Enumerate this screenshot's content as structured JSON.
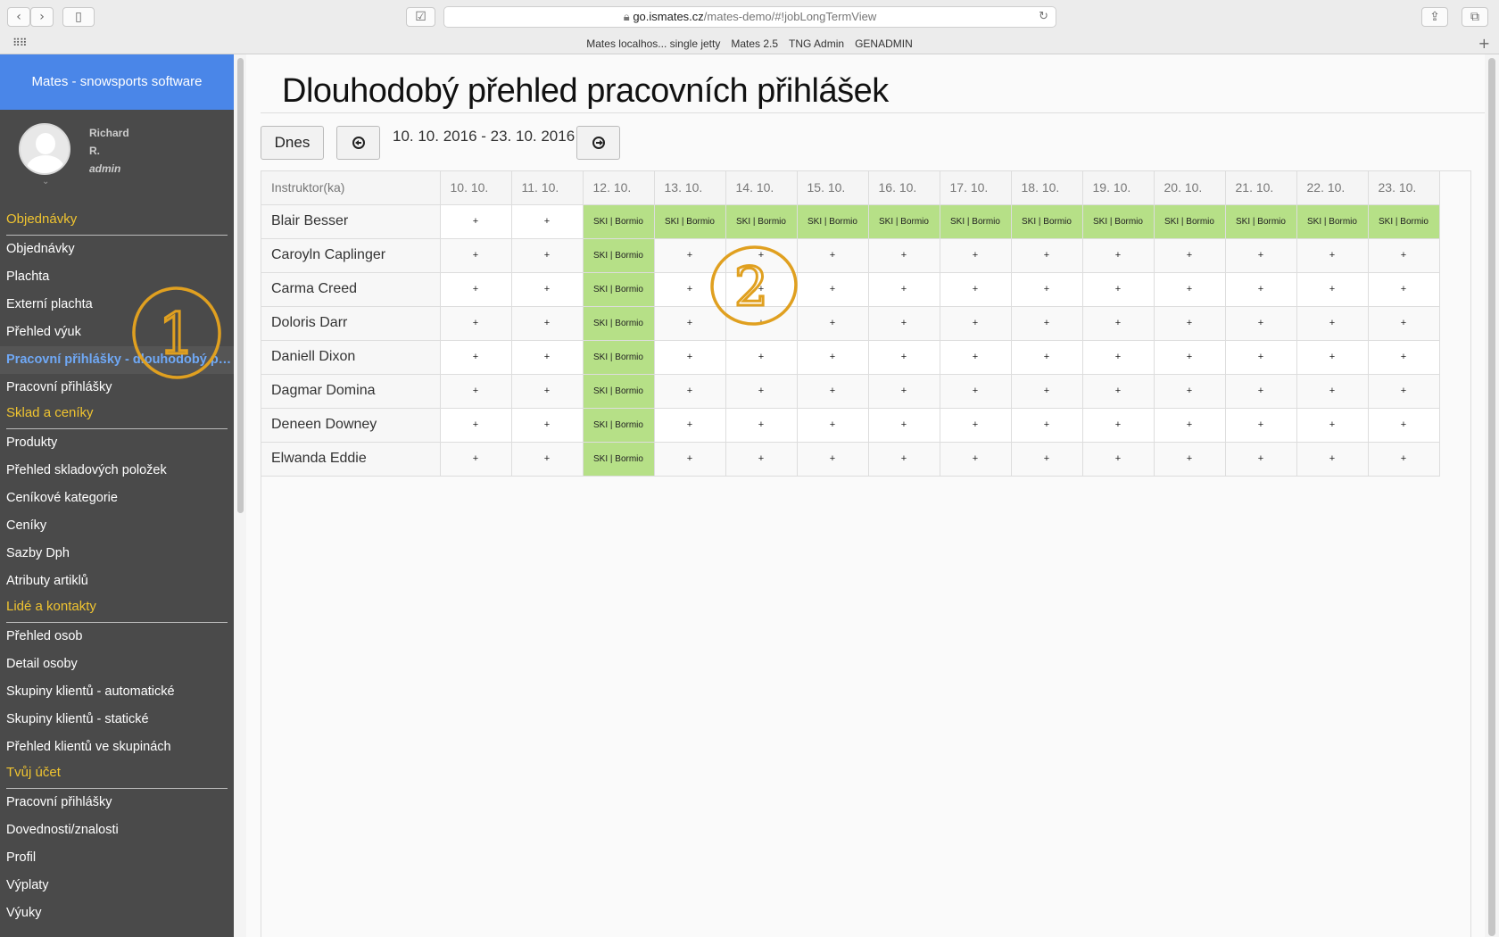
{
  "browser": {
    "url_host": "go.ismates.cz",
    "url_path": "/mates-demo/#!jobLongTermView",
    "bookmarks": [
      "Mates localhos... single jetty",
      "Mates 2.5",
      "TNG Admin",
      "GENADMIN"
    ]
  },
  "sidebar": {
    "brand": "Mates - snowsports software",
    "user": {
      "first": "Richard",
      "last": "R.",
      "role": "admin"
    },
    "sections": [
      {
        "title": "Objednávky",
        "items": [
          "Objednávky",
          "Plachta",
          "Externí plachta",
          "Přehled výuk",
          "Pracovní přihlášky - dlouhodobý přehled",
          "Pracovní přihlášky"
        ]
      },
      {
        "title": "Sklad a ceníky",
        "items": [
          "Produkty",
          "Přehled skladových položek",
          "Ceníkové kategorie",
          "Ceníky",
          "Sazby Dph",
          "Atributy artiklů"
        ]
      },
      {
        "title": "Lidé a kontakty",
        "items": [
          "Přehled osob",
          "Detail osoby",
          "Skupiny klientů - automatické",
          "Skupiny klientů - statické",
          "Přehled klientů ve skupinách"
        ]
      },
      {
        "title": "Tvůj účet",
        "items": [
          "Pracovní přihlášky",
          "Dovednosti/znalosti",
          "Profil",
          "Výplaty",
          "Výuky"
        ]
      }
    ],
    "active_item": "Pracovní přihlášky - dlouhodobý přehled"
  },
  "main": {
    "title": "Dlouhodobý přehled pracovních přihlášek",
    "today_label": "Dnes",
    "date_range": "10. 10. 2016 - 23. 10. 2016",
    "table": {
      "header_first": "Instruktor(ka)",
      "days": [
        "10. 10.",
        "11. 10.",
        "12. 10.",
        "13. 10.",
        "14. 10.",
        "15. 10.",
        "16. 10.",
        "17. 10.",
        "18. 10.",
        "19. 10.",
        "20. 10.",
        "21. 10.",
        "22. 10.",
        "23. 10."
      ],
      "booking_label": "SKI | Bormio",
      "empty_label": "+",
      "rows": [
        {
          "name": "Blair Besser",
          "booked": [
            2,
            3,
            4,
            5,
            6,
            7,
            8,
            9,
            10,
            11,
            12,
            13
          ]
        },
        {
          "name": "Caroyln Caplinger",
          "booked": [
            2
          ]
        },
        {
          "name": "Carma Creed",
          "booked": [
            2
          ]
        },
        {
          "name": "Doloris Darr",
          "booked": [
            2
          ]
        },
        {
          "name": "Daniell Dixon",
          "booked": [
            2
          ]
        },
        {
          "name": "Dagmar Domina",
          "booked": [
            2
          ]
        },
        {
          "name": "Deneen Downey",
          "booked": [
            2
          ]
        },
        {
          "name": "Elwanda Eddie",
          "booked": [
            2
          ]
        }
      ]
    }
  },
  "annotations": [
    "1",
    "2"
  ],
  "colors": {
    "brand": "#4a86e8",
    "sidebar": "#4a4a4a",
    "section": "#f0c430",
    "booked": "#b6e087",
    "annotation": "#e0a020"
  }
}
